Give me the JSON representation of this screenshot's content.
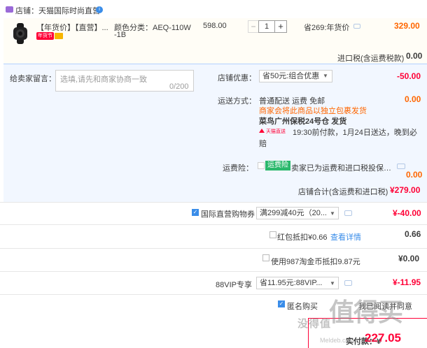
{
  "store": {
    "label": "店铺：天猫国际时尚直营",
    "badge": "i"
  },
  "product": {
    "title": "【年货价】【直营】...",
    "tag": "年货节",
    "sku_label": "颜色分类：AEQ-110W",
    "sku_cont": "-1B",
    "unit_price": "598.00",
    "quantity": "1",
    "minus": "−",
    "plus": "+",
    "promo": "省269:年货价",
    "subtotal": "329.00"
  },
  "import_tax": {
    "label": "进口税(含运费税款)",
    "value": "0.00"
  },
  "message": {
    "label": "给卖家留言：",
    "placeholder": "选填,请先和商家协商一致",
    "counter": "0/200"
  },
  "store_discount": {
    "label": "店铺优惠：",
    "selected": "省50元:组合优惠",
    "value": "-50.00"
  },
  "shipping": {
    "label": "运送方式：",
    "method": "普通配送 运费 免邮",
    "note": "商家会将此商品以独立包裹发货",
    "warehouse": "菜鸟广州保税24号仓  发货",
    "logo_text": "天猫直送",
    "time": "19:30前付款，1月24日送达，晚到必",
    "time_cont": "赔",
    "value": "0.00"
  },
  "freight_insurance": {
    "label": "运费险：",
    "badge": "运费险",
    "text": "卖家已为运费和进口税投保，...",
    "value": "0.00"
  },
  "store_total": {
    "label": "店铺合计(含运费和进口税)",
    "value": "¥279.00"
  },
  "coupon": {
    "label": "国际直营购物券",
    "selected": "满299减40元（20...",
    "value": "¥-40.00"
  },
  "red_packet": {
    "label": "红包抵扣¥0.66",
    "link": "查看详情",
    "value": "0.66"
  },
  "tao_coins": {
    "label": "使用987淘金币抵扣9.87元",
    "value": "¥0.00"
  },
  "vip88": {
    "label": "88VIP专享",
    "selected": "省11.95元:88VIP...",
    "value": "¥-11.95"
  },
  "anonymous": {
    "label": "匿名购买",
    "extra": "我已阅读并同意"
  },
  "payment": {
    "label": "实付款：¥",
    "value": "227.05"
  },
  "watermark": {
    "big": "值得买",
    "text": "没得值",
    "sub": "Meldeb.com    zhidemai"
  },
  "colors": {
    "accent_red": "#ff0036",
    "accent_orange": "#ff6600",
    "link_blue": "#3a8de9",
    "panel_blue": "#f2f7ff"
  },
  "icons": {
    "store": "shop-icon",
    "product": "watch-thumbnail",
    "chat": "chat-bubble-icon",
    "caret": "chevron-down-icon"
  }
}
